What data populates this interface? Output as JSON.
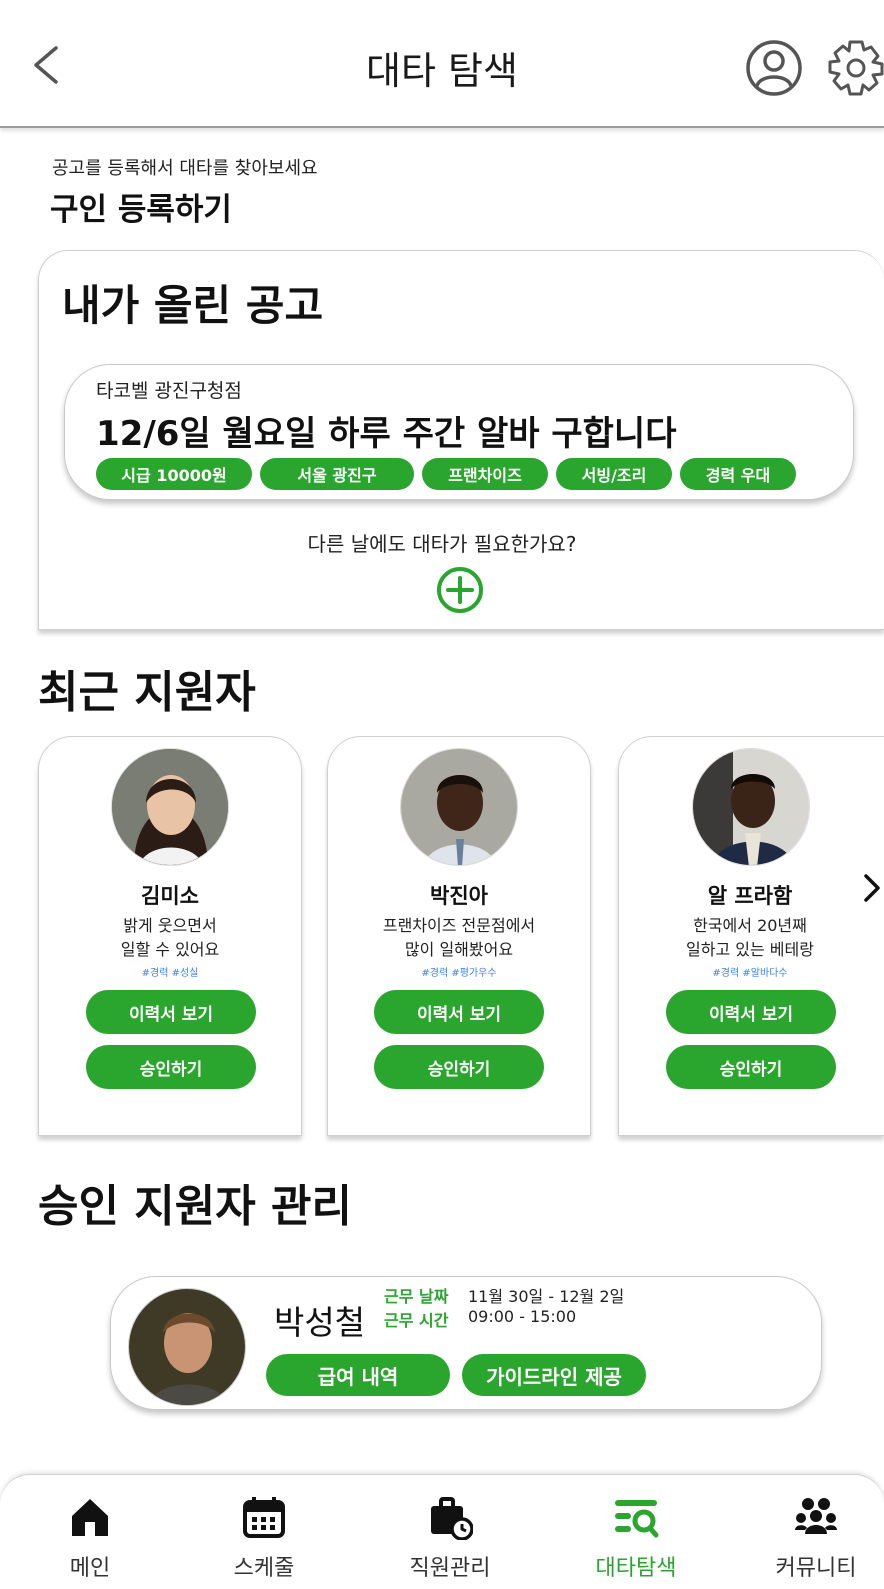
{
  "header": {
    "title": "대타 탐색",
    "back_icon": "chevron-left-icon",
    "profile_icon": "user-circle-icon",
    "settings_icon": "gear-icon"
  },
  "register": {
    "subtitle": "공고를 등록해서 대타를 찾아보세요",
    "title": "구인 등록하기"
  },
  "my_posts": {
    "title": "내가 올린 공고",
    "post": {
      "store": "타코벨 광진구청점",
      "headline": "12/6일 월요일 하루 주간 알바 구합니다",
      "tags": [
        "시급 10000원",
        "서울 광진구",
        "프랜차이즈",
        "서빙/조리",
        "경력 우대"
      ]
    },
    "other_day_prompt": "다른 날에도 대타가 필요한가요?",
    "add_icon": "plus-circle-icon"
  },
  "recent": {
    "title": "최근 지원자",
    "applicants": [
      {
        "name": "김미소",
        "desc1": "밝게 웃으면서",
        "desc2": "일할 수 있어요",
        "tags": "#경력 #성실",
        "resume": "이력서 보기",
        "approve": "승인하기"
      },
      {
        "name": "박진아",
        "desc1": "프랜차이즈 전문점에서",
        "desc2": "많이 일해봤어요",
        "tags": "#경력 #평가우수",
        "resume": "이력서 보기",
        "approve": "승인하기"
      },
      {
        "name": "알 프라함",
        "desc1": "한국에서 20년째",
        "desc2": "일하고 있는 베테랑",
        "tags": "#경력 #알바다수",
        "resume": "이력서 보기",
        "approve": "승인하기"
      }
    ],
    "next_icon": "chevron-right-icon"
  },
  "approved": {
    "title": "승인 지원자 관리",
    "name": "박성철",
    "date_label": "근무 날짜",
    "date_value": "11월 30일 - 12월 2일",
    "time_label": "근무 시간",
    "time_value": "09:00 - 15:00",
    "pay_button": "급여 내역",
    "guide_button": "가이드라인 제공"
  },
  "nav": {
    "items": [
      {
        "label": "메인",
        "icon": "home-icon"
      },
      {
        "label": "스케줄",
        "icon": "calendar-icon"
      },
      {
        "label": "직원관리",
        "icon": "briefcase-clock-icon"
      },
      {
        "label": "대타탐색",
        "icon": "list-search-icon"
      },
      {
        "label": "커뮤니티",
        "icon": "people-group-icon"
      }
    ],
    "active_index": 3
  },
  "colors": {
    "accent": "#2aa52e",
    "tag_text": "#3b82f6"
  }
}
